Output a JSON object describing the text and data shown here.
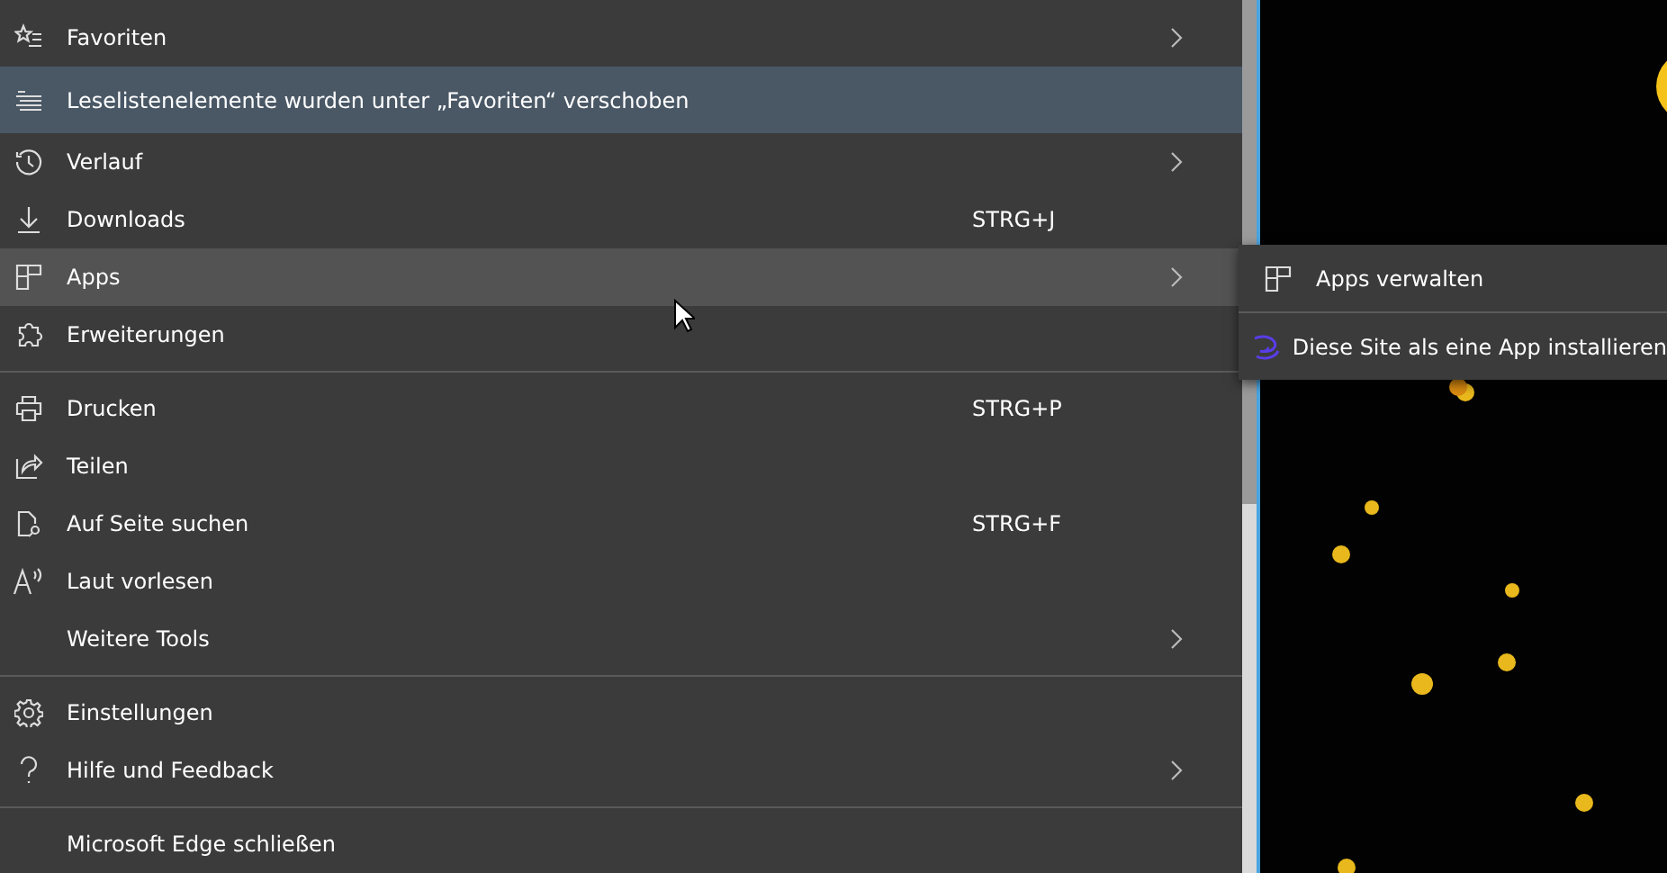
{
  "menu": {
    "groups": [
      {
        "items": [
          {
            "kind": "item",
            "label": "Favoriten",
            "has_submenu": true,
            "selected": false
          },
          {
            "kind": "notice",
            "label": "Leselistenelemente wurden unter „Favoriten“ verschoben"
          },
          {
            "kind": "item",
            "label": "Verlauf",
            "has_submenu": true,
            "selected": false
          },
          {
            "kind": "item",
            "label": "Downloads",
            "shortcut": "STRG+J",
            "selected": false
          },
          {
            "kind": "item",
            "label": "Apps",
            "has_submenu": true,
            "selected": true
          },
          {
            "kind": "item",
            "label": "Erweiterungen",
            "selected": false
          }
        ]
      },
      {
        "items": [
          {
            "kind": "item",
            "label": "Drucken",
            "shortcut": "STRG+P",
            "selected": false
          },
          {
            "kind": "item",
            "label": "Teilen",
            "selected": false
          },
          {
            "kind": "item",
            "label": "Auf Seite suchen",
            "shortcut": "STRG+F",
            "selected": false
          },
          {
            "kind": "item",
            "label": "Laut vorlesen",
            "selected": false
          },
          {
            "kind": "item",
            "label": "Weitere Tools",
            "has_submenu": true,
            "selected": false
          }
        ]
      },
      {
        "items": [
          {
            "kind": "item",
            "label": "Einstellungen",
            "selected": false
          },
          {
            "kind": "item",
            "label": "Hilfe und Feedback",
            "has_submenu": true,
            "selected": false
          }
        ]
      },
      {
        "items": [
          {
            "kind": "item",
            "label": "Microsoft Edge schließen",
            "selected": false
          }
        ]
      }
    ]
  },
  "submenu": {
    "items": [
      {
        "label": "Apps verwalten"
      },
      {
        "label": "Diese Site als eine App installieren"
      }
    ]
  }
}
